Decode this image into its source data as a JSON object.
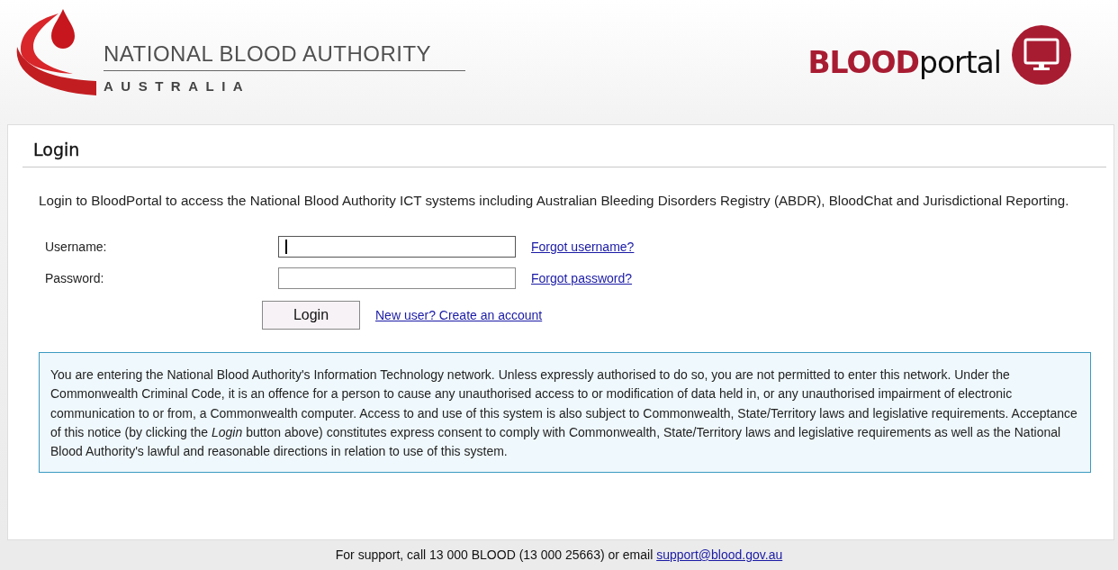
{
  "header": {
    "org_name": "NATIONAL BLOOD AUTHORITY",
    "org_country": "AUSTRALIA",
    "portal_logo": "**BLOOD**portal"
  },
  "login": {
    "title": "Login",
    "intro": "Login to BloodPortal to access the National Blood Authority ICT systems including Australian Bleeding Disorders Registry (ABDR), BloodChat and Jurisdictional Reporting.",
    "fields": [
      {
        "label": "Username:",
        "link": "Forgot username?",
        "focused": true
      },
      {
        "label": "Password:",
        "link": "Forgot password?",
        "focused": false
      }
    ],
    "button": "Login",
    "register_link": "New user? Create an account",
    "notice": "You are entering the National Blood Authority's Information Technology network. Unless expressly authorised to do so, you are not permitted to enter this network. Under the Commonwealth Criminal Code, it is an offence for a person to cause any unauthorised access to or modification of data held in, or any unauthorised impairment of electronic communication to or from, a Commonwealth computer. Access to and use of this system is also subject to Commonwealth, State/Territory laws and legislative requirements. Acceptance of this notice (by clicking the *Login* button above) constitutes express consent to comply with Commonwealth, State/Territory laws and legislative requirements as well as the National Blood Authority's lawful and reasonable directions in relation to use of this system."
  },
  "footer": {
    "text": "For support, call 13 000 BLOOD (13 000 25663) or email",
    "email": "support@blood.gov.au"
  }
}
